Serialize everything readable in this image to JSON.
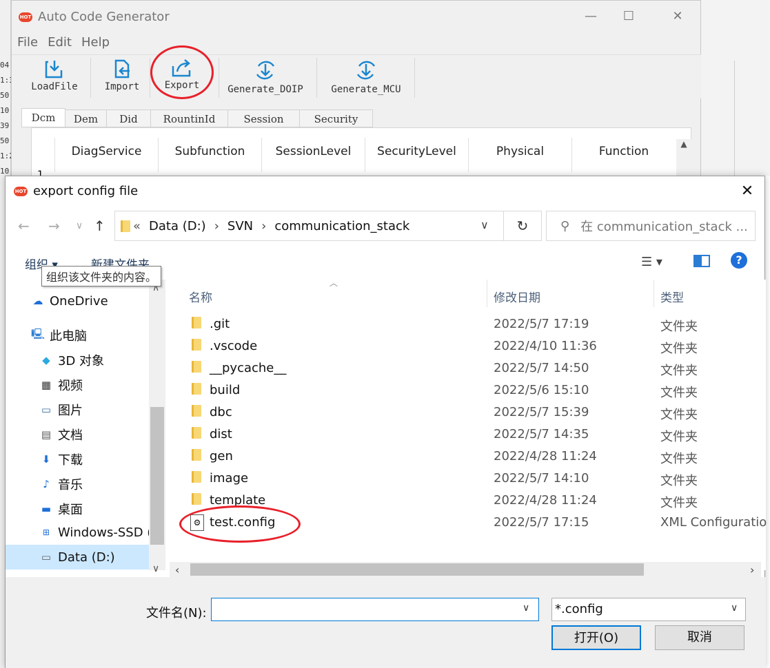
{
  "app": {
    "title": "Auto Code Generator",
    "badge": "HOT",
    "menu": [
      "File",
      "Edit",
      "Help"
    ],
    "toolbar": [
      "LoadFile",
      "Import",
      "Export",
      "Generate_DOIP",
      "Generate_MCU"
    ],
    "tabs": [
      "Dcm",
      "Dem",
      "Did",
      "RountinId",
      "Session",
      "Security"
    ],
    "grid_columns": [
      "DiagService",
      "Subfunction",
      "SessionLevel",
      "SecurityLevel",
      "Physical",
      "Function"
    ],
    "row_number": "1",
    "left_strip_numbers": [
      "04",
      "1:3",
      "50",
      "10",
      "39",
      "50",
      "1:2",
      "10"
    ]
  },
  "dialog": {
    "title": "export config file",
    "badge": "HOT",
    "path": [
      "Data (D:)",
      "SVN",
      "communication_stack"
    ],
    "path_prefix": "«",
    "search_placeholder": "在 communication_stack ...",
    "organize": "组织 ▾",
    "new_folder": "新建文件夹",
    "tooltip": "组织该文件夹的内容。",
    "nav": [
      {
        "label": "OneDrive",
        "icon": "cloud-icon"
      },
      {
        "label": "此电脑",
        "icon": "computer-icon"
      },
      {
        "label": "3D 对象",
        "icon": "cube-icon"
      },
      {
        "label": "视频",
        "icon": "video-icon"
      },
      {
        "label": "图片",
        "icon": "picture-icon"
      },
      {
        "label": "文档",
        "icon": "document-icon"
      },
      {
        "label": "下载",
        "icon": "download-icon"
      },
      {
        "label": "音乐",
        "icon": "music-icon"
      },
      {
        "label": "桌面",
        "icon": "desktop-icon"
      },
      {
        "label": "Windows-SSD (",
        "icon": "windows-drive-icon"
      },
      {
        "label": "Data (D:)",
        "icon": "drive-icon"
      }
    ],
    "columns": [
      "名称",
      "修改日期",
      "类型"
    ],
    "files": [
      {
        "name": ".git",
        "date": "2022/5/7 17:19",
        "type": "文件夹",
        "kind": "folder"
      },
      {
        "name": ".vscode",
        "date": "2022/4/10 11:36",
        "type": "文件夹",
        "kind": "folder"
      },
      {
        "name": "__pycache__",
        "date": "2022/5/7 14:50",
        "type": "文件夹",
        "kind": "folder"
      },
      {
        "name": "build",
        "date": "2022/5/6 15:10",
        "type": "文件夹",
        "kind": "folder"
      },
      {
        "name": "dbc",
        "date": "2022/5/7 15:39",
        "type": "文件夹",
        "kind": "folder"
      },
      {
        "name": "dist",
        "date": "2022/5/7 14:35",
        "type": "文件夹",
        "kind": "folder"
      },
      {
        "name": "gen",
        "date": "2022/4/28 11:24",
        "type": "文件夹",
        "kind": "folder"
      },
      {
        "name": "image",
        "date": "2022/5/7 14:10",
        "type": "文件夹",
        "kind": "folder"
      },
      {
        "name": "template",
        "date": "2022/4/28 11:24",
        "type": "文件夹",
        "kind": "folder"
      },
      {
        "name": "test.config",
        "date": "2022/5/7 17:15",
        "type": "XML Configuratio",
        "kind": "file"
      }
    ],
    "filename_label": "文件名(N):",
    "filename_value": "",
    "filetype": "*.config",
    "open_button": "打开(O)",
    "cancel_button": "取消"
  },
  "colors": {
    "accent": "#0078d7",
    "annotation": "#e8202a",
    "hot": "#e8462d"
  }
}
